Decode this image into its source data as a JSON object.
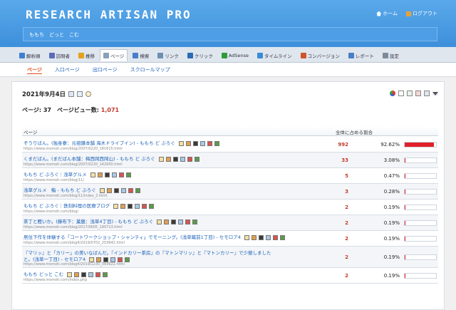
{
  "app": {
    "logo": "RESEARCH ARTISAN PRO",
    "home_label": "ホーム",
    "logout_label": "ログアウト",
    "subtitle": "ももち　どっと　こむ"
  },
  "tabs": [
    {
      "label": "解析順",
      "color": "#3d7fd0"
    },
    {
      "label": "訪問者",
      "color": "#5a6db8"
    },
    {
      "label": "推移",
      "color": "#e3a21a"
    },
    {
      "label": "ページ",
      "color": "#8aa0b8"
    },
    {
      "label": "検索",
      "color": "#4a7ec9"
    },
    {
      "label": "リンク",
      "color": "#6d8fb3"
    },
    {
      "label": "クリック",
      "color": "#2b6bb5"
    },
    {
      "label": "AdSense",
      "color": "#2f9a3a"
    },
    {
      "label": "タイムライン",
      "color": "#3a8bd6"
    },
    {
      "label": "コンバージョン",
      "color": "#d0542a"
    },
    {
      "label": "レポート",
      "color": "#4a7ec9"
    },
    {
      "label": "設定",
      "color": "#7c8a99"
    }
  ],
  "subnav": [
    "ページ",
    "入口ページ",
    "出口ページ",
    "スクロールマップ"
  ],
  "date": "2021年9月4日",
  "summary": {
    "label": "ページ: 37　ページビュー数: ",
    "pv": "1,071"
  },
  "table": {
    "col_page": "ページ",
    "col_share": "全体に占める割合",
    "rows": [
      {
        "title": "ぞうりばん。(独身寮：元祖鎌本舗 海木ドライブイン) - ももち ど ぶろぐ",
        "title2": "",
        "url": "https://www.momoti.com/blog/2007/0220_181615.html",
        "count": "992",
        "pct": "92.62%",
        "fill": 0.9262
      },
      {
        "title": "くまだばん。(まだばん本舗：梅西岡西岡山) - ももち ど ぶろぐ",
        "title2": "",
        "url": "https://www.momoti.com/blog/2007/0220_142950.html",
        "count": "33",
        "pct": "3.08%",
        "fill": 0.0308
      },
      {
        "title": "ももち ど ぶろぐ｜浅草グルメ",
        "title2": "",
        "url": "https://www.momoti.com/blog/11/",
        "count": "5",
        "pct": "0.47%",
        "fill": 0.0047
      },
      {
        "title": "浅草グルメ　鮨 - ももち ど ぶろぐ",
        "title2": "",
        "url": "https://www.momoti.com/blog/11/index_2.html",
        "count": "3",
        "pct": "0.28%",
        "fill": 0.0028
      },
      {
        "title": "ももち ど ぶろぐ｜鉄刻料理の医療ブログ",
        "title2": "",
        "url": "https://www.momoti.com/blog/",
        "count": "2",
        "pct": "0.19%",
        "fill": 0.0019
      },
      {
        "title": "茶丁と鰹いか。(藤布下：菓膳：浅草4丁目) - ももち ど ぶろぐ",
        "title2": "",
        "url": "https://www.momoti.com/blog/2017/0605_190713.html",
        "count": "2",
        "pct": "0.19%",
        "fill": 0.0019
      },
      {
        "title": "居住下作を体験する「コートワークショップ・シャンティ」でモーニング。(浅草蔵前1丁目) - セモロア4",
        "title2": "",
        "url": "https://www.momoti.com/blog4/2019/0702_253642.html",
        "count": "2",
        "pct": "0.19%",
        "fill": 0.0019
      },
      {
        "title": "『マリッ』と「カリー」の美いなばんだ。『インドカリー茶房』の『マトンマリッ』と『マトンカリー』で少憩しました",
        "title2": "と。(浅草一丁目) - セモロア4",
        "url": "https://www.momoti.com/blog4/2019/1230_093622.html",
        "count": "2",
        "pct": "0.19%",
        "fill": 0.0019
      },
      {
        "title": "ももち どっと こむ",
        "title2": "",
        "url": "https://www.momoti.com/index.php",
        "count": "2",
        "pct": "0.19%",
        "fill": 0.0019
      }
    ]
  }
}
